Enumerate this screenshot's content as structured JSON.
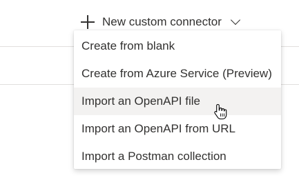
{
  "toolbar": {
    "new_connector_label": "New custom connector",
    "plus_icon": "plus-icon",
    "chevron_icon": "chevron-down-icon"
  },
  "menu": {
    "items": [
      {
        "label": "Create from blank"
      },
      {
        "label": "Create from Azure Service (Preview)"
      },
      {
        "label": "Import an OpenAPI file",
        "hovered": true
      },
      {
        "label": "Import an OpenAPI from URL"
      },
      {
        "label": "Import a Postman collection"
      }
    ]
  },
  "cursor": {
    "icon": "hand-pointer-icon"
  },
  "colors": {
    "text": "#323130",
    "hover_bg": "#f3f2f1",
    "divider": "#e1dfdd"
  }
}
